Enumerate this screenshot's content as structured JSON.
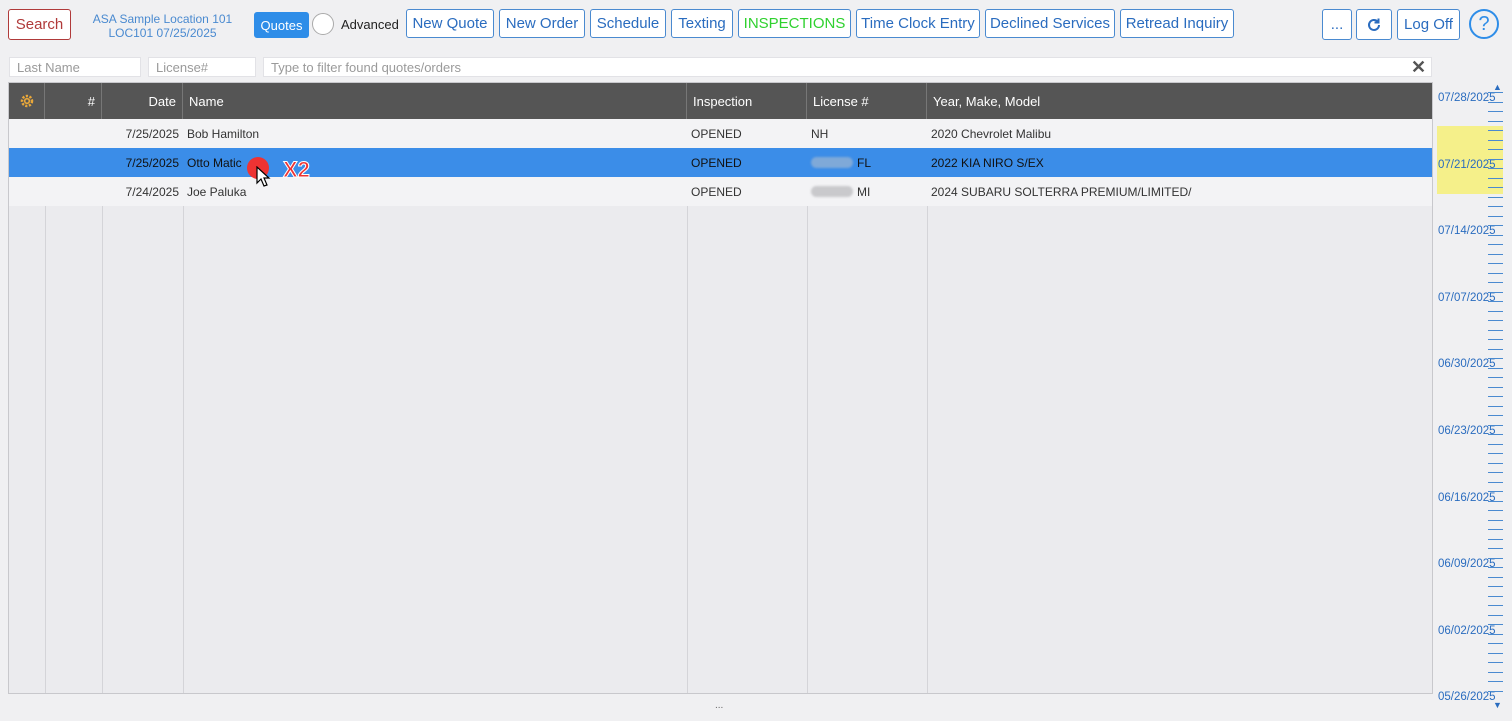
{
  "toolbar": {
    "search": "Search",
    "location_name": "ASA Sample Location 101",
    "location_code": "LOC101 07/25/2025",
    "quotes": "Quotes",
    "advanced": "Advanced",
    "new_quote": "New Quote",
    "new_order": "New Order",
    "schedule": "Schedule",
    "texting": "Texting",
    "inspections": "INSPECTIONS",
    "time_clock": "Time Clock Entry",
    "declined": "Declined Services",
    "retread": "Retread Inquiry",
    "more": "...",
    "log_off": "Log Off",
    "help": "?"
  },
  "filters": {
    "last_name_placeholder": "Last Name",
    "license_placeholder": "License#",
    "filter_placeholder": "Type to filter found quotes/orders"
  },
  "table": {
    "headers": {
      "num": "#",
      "date": "Date",
      "name": "Name",
      "inspection": "Inspection",
      "license": "License #",
      "ymm": "Year, Make, Model"
    },
    "rows": [
      {
        "date": "7/25/2025",
        "name": "Bob Hamilton",
        "inspection": "OPENED",
        "license_state": "NH",
        "ymm": "2020 Chevrolet Malibu"
      },
      {
        "date": "7/25/2025",
        "name": "Otto Matic",
        "inspection": "OPENED",
        "license_state": "FL",
        "ymm": "2022 KIA NIRO S/EX"
      },
      {
        "date": "7/24/2025",
        "name": "Joe Paluka",
        "inspection": "OPENED",
        "license_state": "MI",
        "ymm": "2024 SUBARU SOLTERRA PREMIUM/LIMITED/"
      }
    ]
  },
  "timeline": {
    "dates": [
      "07/28/2025",
      "07/21/2025",
      "07/14/2025",
      "07/07/2025",
      "06/30/2025",
      "06/23/2025",
      "06/16/2025",
      "06/09/2025",
      "06/02/2025",
      "05/26/2025"
    ]
  },
  "overlay": {
    "click_label": "X2"
  },
  "footer": {
    "resize": "..."
  }
}
